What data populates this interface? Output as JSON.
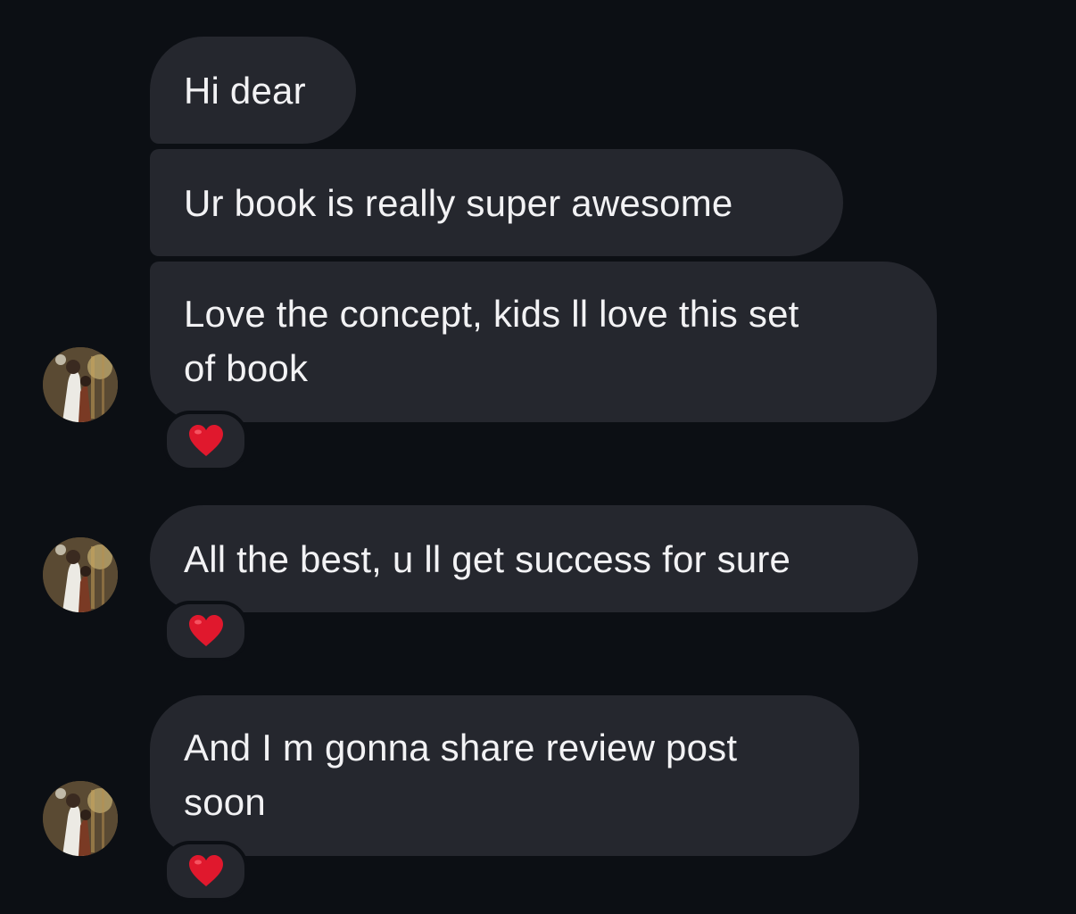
{
  "messages": [
    {
      "lines": [
        "Hi dear"
      ]
    },
    {
      "lines": [
        "Ur book is really super awesome"
      ]
    },
    {
      "lines": [
        "Love the concept, kids ll love this set",
        "of book"
      ],
      "reaction": "heart-emoji"
    },
    {
      "lines": [
        "All the best, u ll get success for sure"
      ],
      "reaction": "heart-emoji"
    },
    {
      "lines": [
        "And I m gonna share review post",
        "soon"
      ],
      "reaction": "heart-emoji"
    }
  ],
  "colors": {
    "background": "#0c0f14",
    "bubble": "#25272e",
    "text": "#f2f2f4",
    "heart": "#e0182d"
  },
  "icons": {
    "avatar": "profile-photo-avatar",
    "reaction": "red-heart-icon"
  }
}
